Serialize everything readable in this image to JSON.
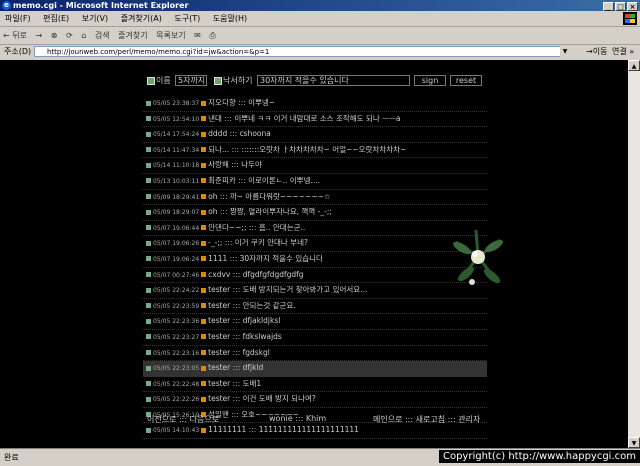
{
  "window": {
    "title": "memo.cgi - Microsoft Internet Explorer",
    "buttons": [
      "_",
      "□",
      "×"
    ]
  },
  "menu": [
    "파일(F)",
    "편집(E)",
    "보기(V)",
    "즐겨찾기(A)",
    "도구(T)",
    "도움말(H)"
  ],
  "toolbar": {
    "back": "← 뒤로",
    "forward": "→",
    "stop": "⊗",
    "refresh": "⟳",
    "home": "⌂",
    "search": "검색",
    "favorites": "즐겨찾기",
    "history": "목록보기",
    "mail": "✉",
    "print": "⎙"
  },
  "address": {
    "label": "주소(D)",
    "url": "http://jounweb.com/perl/memo/memo.cgi?id=jw&action=&p=1",
    "go": "→이동",
    "links": "연결 »"
  },
  "form": {
    "name_label": "이름",
    "name_value": "5자까지",
    "secret_label": "낙서하기",
    "message_value": "30자까지 적을수 있습니다",
    "sign": "sign",
    "reset": "reset"
  },
  "memos": [
    {
      "ts": "05/05 23:38:37",
      "name": "지오디향",
      "msg": "이뿌넹~"
    },
    {
      "ts": "05/05 12:54:10",
      "name": "낸대",
      "msg": "이뿌네 ㅋㅋ 이거 내맘대로 소스 조작해도 되나 ㅡㅡa"
    },
    {
      "ts": "05/14 17:54:24",
      "name": "dddd",
      "msg": "cshoona"
    },
    {
      "ts": "05/14 11:47:34",
      "name": "되나...",
      "msg": ":::::::오랏차 ㅏ차차차차차~ 어얼~~오랏차차차차~"
    },
    {
      "ts": "05/14 11:10:18",
      "name": "사랑해",
      "msg": "나두야"
    },
    {
      "ts": "05/13 10:03:11",
      "name": "최준피카",
      "msg": "이로이론ㄴ.. 이뿌넹...."
    },
    {
      "ts": "05/09 18:29:41",
      "name": "oh",
      "msg": "까~ 아름다워랏~~~~~~~☆"
    },
    {
      "ts": "05/09 18:29:07",
      "name": "oh",
      "msg": "짱짱, 열라이뿌자나요, 껵껵 -_-;;"
    },
    {
      "ts": "05/07 19:06:44",
      "name": "안댄다~~;;",
      "msg": "흠.. 안대는군.."
    },
    {
      "ts": "05/07 19:06:26",
      "name": "-_-;;",
      "msg": "이거 쿠키 안대나 부네?"
    },
    {
      "ts": "05/07 19:06:24",
      "name": "1111",
      "msg": "30자까지 적을수 있습니다"
    },
    {
      "ts": "05/07 00:27:46",
      "name": "cxdvv",
      "msg": "dfgdfgfdgdfgdfg"
    },
    {
      "ts": "05/05 22:24:22",
      "name": "tester",
      "msg": "도배 방지되는거 찾아봐가고 있어서요..."
    },
    {
      "ts": "05/05 22:23:59",
      "name": "tester",
      "msg": "안되는것 같군요."
    },
    {
      "ts": "05/05 22:23:36",
      "name": "tester",
      "msg": "dfjakldjksl"
    },
    {
      "ts": "05/05 22:23:27",
      "name": "tester",
      "msg": "fdkslwajds"
    },
    {
      "ts": "05/05 22:23:16",
      "name": "tester",
      "msg": "fgdskgl"
    },
    {
      "ts": "05/05 22:23:05",
      "name": "tester",
      "msg": "dfjkld"
    },
    {
      "ts": "05/05 22:22:48",
      "name": "tester",
      "msg": "도배1"
    },
    {
      "ts": "05/05 22:22:26",
      "name": "tester",
      "msg": "이건 도배 방지 되나여?"
    },
    {
      "ts": "05/05 15:26:19",
      "name": "성일맨",
      "msg": "오호~~~~~~~"
    },
    {
      "ts": "05/05 14:10:43",
      "name": "11111111",
      "msg": "111111111111111111111"
    }
  ],
  "highlight_index": 17,
  "footer": {
    "prev_next": "이전으로 ::: 다음으로",
    "credit": "wonie ::: Khim",
    "links": "메인으로 ::: 새로고침 ::: 관리자"
  },
  "status": {
    "text": "완료",
    "copyright": "Copyright(c) http://www.happycgi.com"
  }
}
